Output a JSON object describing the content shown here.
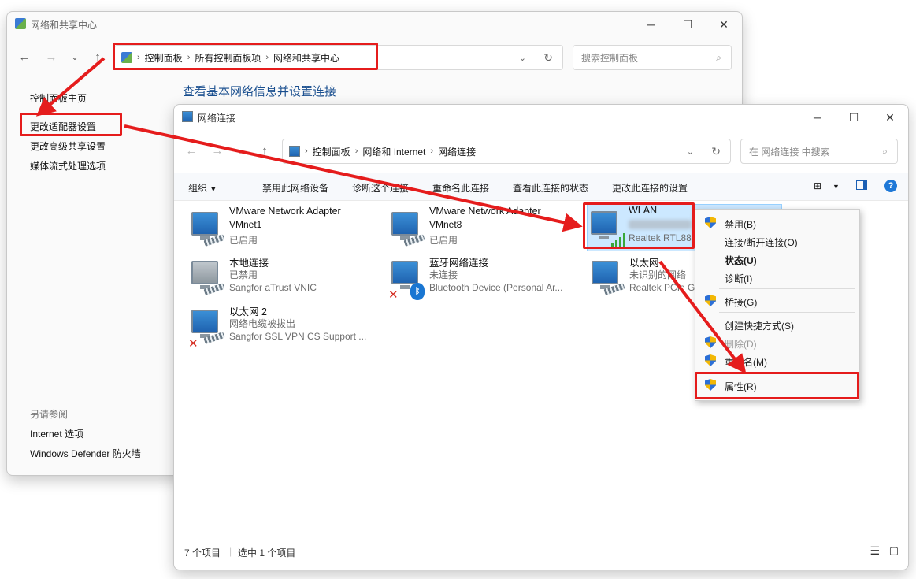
{
  "back_window": {
    "title": "网络和共享中心",
    "breadcrumb": [
      "控制面板",
      "所有控制面板项",
      "网络和共享中心"
    ],
    "search_placeholder": "搜索控制面板",
    "heading": "查看基本网络信息并设置连接",
    "left_links": [
      "控制面板主页",
      "更改适配器设置",
      "更改高级共享设置",
      "媒体流式处理选项"
    ],
    "see_also_title": "另请参阅",
    "see_also_links": [
      "Internet 选项",
      "Windows Defender 防火墙"
    ]
  },
  "front_window": {
    "title": "网络连接",
    "breadcrumb": [
      "控制面板",
      "网络和 Internet",
      "网络连接"
    ],
    "search_placeholder": "在 网络连接 中搜索",
    "toolbar": {
      "organize": "组织",
      "disable": "禁用此网络设备",
      "diagnose": "诊断这个连接",
      "rename": "重命名此连接",
      "view_status": "查看此连接的状态",
      "change_settings": "更改此连接的设置"
    },
    "connections": [
      {
        "name": "VMware Network Adapter VMnet1",
        "line1": "VMware Network Adapter",
        "line2": "VMnet1",
        "status": "已启用"
      },
      {
        "name": "VMware Network Adapter VMnet8",
        "line1": "VMware Network Adapter",
        "line2": "VMnet8",
        "status": "已启用"
      },
      {
        "name": "WLAN",
        "line1": "WLAN",
        "line2": "",
        "status": "Realtek RTL88"
      },
      {
        "name": "本地连接",
        "line1": "本地连接",
        "line2": "已禁用",
        "status": "Sangfor aTrust VNIC"
      },
      {
        "name": "蓝牙网络连接",
        "line1": "蓝牙网络连接",
        "line2": "未连接",
        "status": "Bluetooth Device (Personal Ar..."
      },
      {
        "name": "以太网",
        "line1": "以太网",
        "line2": "未识别的网络",
        "status": "Realtek PCIe G"
      },
      {
        "name": "以太网 2",
        "line1": "以太网 2",
        "line2": "网络电缆被拔出",
        "status": "Sangfor SSL VPN CS Support ..."
      }
    ],
    "status_bar": {
      "count": "7 个项目",
      "selected": "选中 1 个项目"
    }
  },
  "context_menu": {
    "items": [
      "禁用(B)",
      "连接/断开连接(O)",
      "状态(U)",
      "诊断(I)",
      "桥接(G)",
      "创建快捷方式(S)",
      "删除(D)",
      "重命名(M)",
      "属性(R)"
    ]
  },
  "colors": {
    "highlight_red": "#e51c1c",
    "link_blue": "#1a5fb4",
    "selection": "#cce8ff"
  }
}
